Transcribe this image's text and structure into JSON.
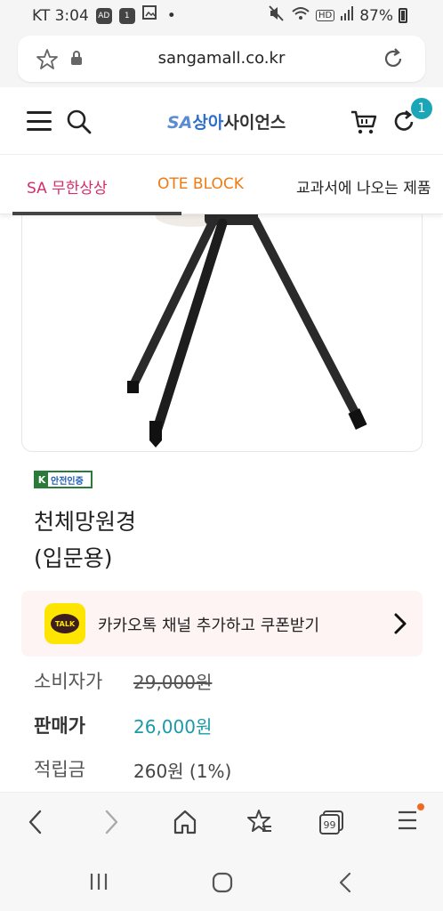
{
  "status_bar": {
    "carrier_time": "KT 3:04",
    "icons": [
      "ad-icon",
      "one-icon",
      "gallery-icon",
      "dot-icon"
    ],
    "right_icons": [
      "mute-icon",
      "wifi-icon",
      "hd-icon",
      "signal-icon"
    ],
    "battery": "87%"
  },
  "browser": {
    "url": "sangamall.co.kr"
  },
  "site_header": {
    "logo_sa": "SA",
    "logo_sanga": "상아",
    "logo_rest": "사이언스",
    "cart_badge": "1"
  },
  "tabs": [
    {
      "label": "SA 무한상상",
      "color": "#d62c6b"
    },
    {
      "label": "OTE BLOCK",
      "color": "#f07a12"
    },
    {
      "label": "교과서에 나오는 제품",
      "color": "#222222"
    }
  ],
  "product": {
    "cert_badge": "안전인증",
    "cert_k": "K",
    "title_line1": "천체망원경",
    "title_line2": "(입문용)",
    "kakao_logo": "TALK",
    "kakao_text": "카카오톡 채널 추가하고 쿠폰받기",
    "consumer_price_label": "소비자가",
    "consumer_price": "29,000원",
    "sale_price_label": "판매가",
    "sale_price": "26,000원",
    "points_label": "적립금",
    "points": "260원 (1%)"
  },
  "bottom_nav": {
    "tabs_count": "99"
  }
}
